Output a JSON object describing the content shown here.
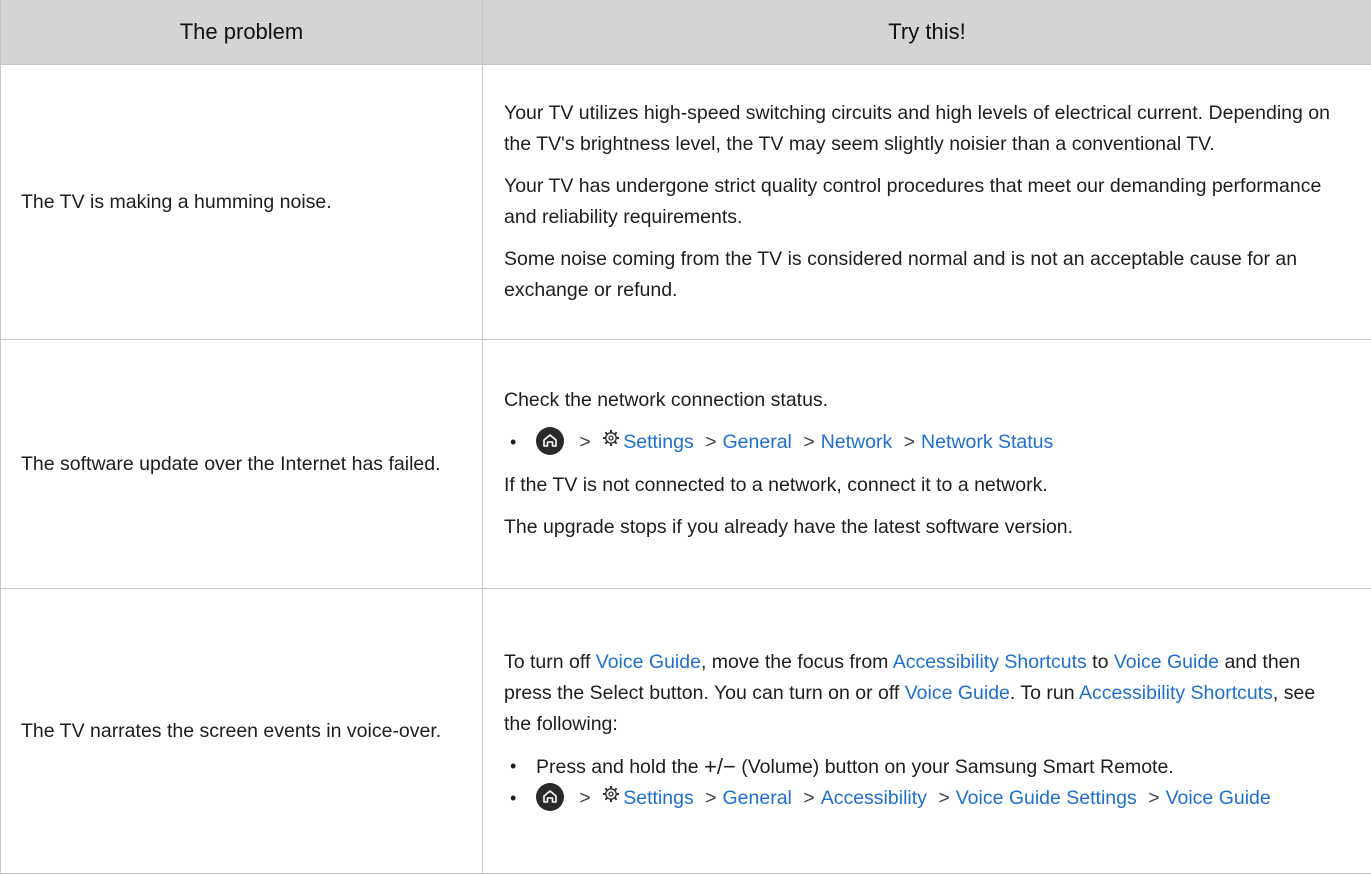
{
  "header": {
    "col1": "The problem",
    "col2": "Try this!"
  },
  "rows": [
    {
      "problem": "The TV is making a humming noise.",
      "p1": "Your TV utilizes high-speed switching circuits and high levels of electrical current. Depending on the TV's brightness level, the TV may seem slightly noisier than a conventional TV.",
      "p2": "Your TV has undergone strict quality control procedures that meet our demanding performance and reliability requirements.",
      "p3": "Some noise coming from the TV is considered normal and is not an acceptable cause for an exchange or refund."
    },
    {
      "problem": "The software update over the Internet has failed.",
      "p1": "Check the network connection status.",
      "path": [
        "Settings",
        "General",
        "Network",
        "Network Status"
      ],
      "p2": "If the TV is not connected to a network, connect it to a network.",
      "p3": "The upgrade stops if you already have the latest software version."
    },
    {
      "problem": "The TV narrates the screen events in voice-over.",
      "t1": "To turn off ",
      "l1": "Voice Guide",
      "t2": ", move the focus from ",
      "l2": "Accessibility Shortcuts",
      "t3": " to ",
      "l3": "Voice Guide",
      "t4": " and then press the Select button. You can turn on or off ",
      "l4": "Voice Guide",
      "t5": ". To run ",
      "l5": "Accessibility Shortcuts",
      "t6": ", see the following:",
      "bullet1_pre": "Press and hold the ",
      "bullet1_symbol": "+/−",
      "bullet1_post": " (Volume) button on your Samsung Smart Remote.",
      "path": [
        "Settings",
        "General",
        "Accessibility",
        "Voice Guide Settings",
        "Voice Guide"
      ]
    }
  ],
  "icons": {
    "home": "home-icon",
    "settings": "gear-icon",
    "chevron": "chevron-right-icon"
  },
  "colors": {
    "link": "#1f6fd1",
    "header_bg": "#d4d4d4",
    "border": "#c8c8c8"
  }
}
